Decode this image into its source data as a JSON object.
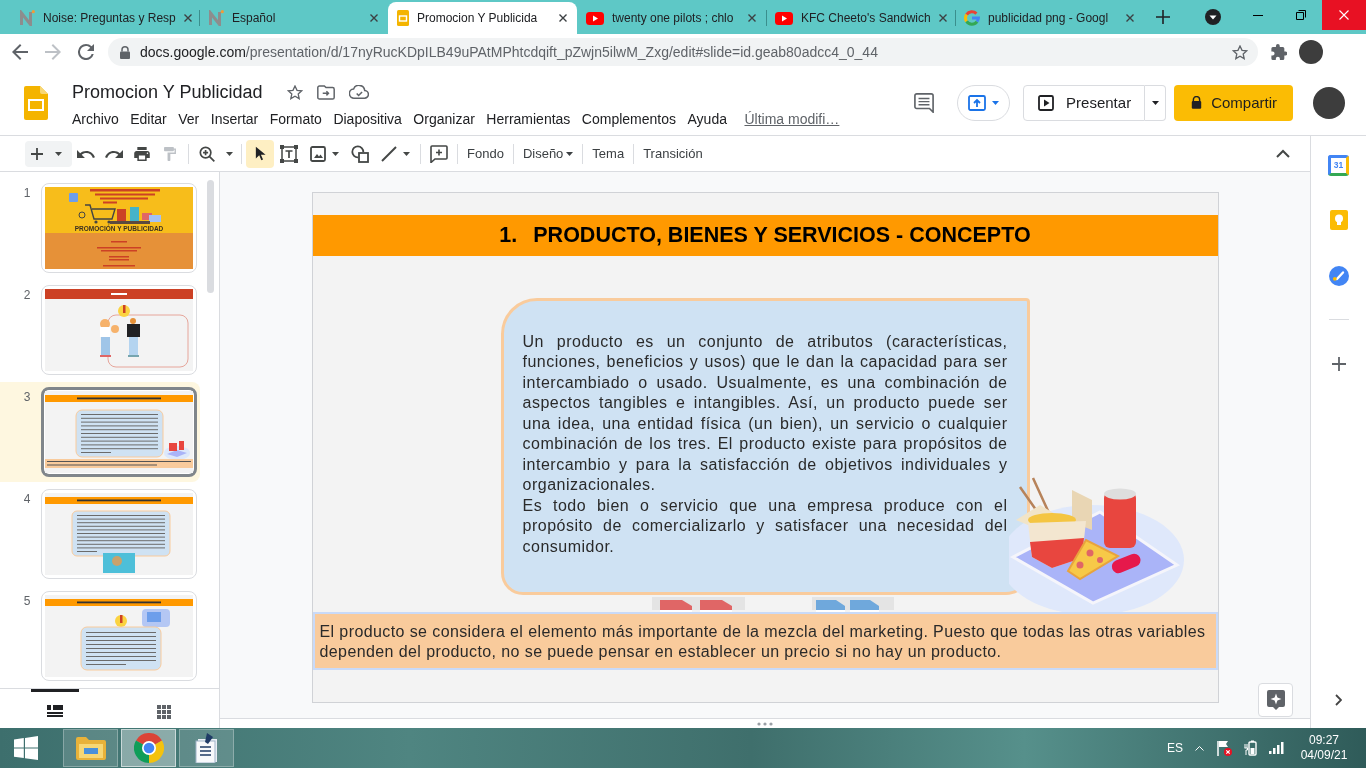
{
  "browser": {
    "tabs": [
      {
        "kind": "noise",
        "title": "Noise: Preguntas y Resp",
        "selected": false
      },
      {
        "kind": "noise",
        "title": "Español",
        "selected": false
      },
      {
        "kind": "slides",
        "title": "Promocion Y Publicida",
        "selected": true
      },
      {
        "kind": "youtube",
        "title": "twenty one pilots ; chlo",
        "selected": false
      },
      {
        "kind": "youtube",
        "title": "KFC Cheeto's Sandwich",
        "selected": false
      },
      {
        "kind": "google",
        "title": "publicidad png - Googl",
        "selected": false
      }
    ],
    "address": {
      "domain": "docs.google.com",
      "path": "/presentation/d/17nyRucKDpILB49uPAtMPhtcdqift_pZwjn5ilwM_Zxg/edit#slide=id.geab80adcc4_0_44"
    }
  },
  "document": {
    "title": "Promocion Y Publicidad",
    "menu": [
      "Archivo",
      "Editar",
      "Ver",
      "Insertar",
      "Formato",
      "Diapositiva",
      "Organizar",
      "Herramientas",
      "Complementos",
      "Ayuda"
    ],
    "last_edit": "Última modifi…",
    "present_button": "Presentar",
    "share_button": "Compartir"
  },
  "toolbar": {
    "tools": [
      {
        "kind": "select",
        "selected": true
      },
      {
        "kind": "textbox",
        "selected": false
      },
      {
        "kind": "image",
        "selected": false
      },
      {
        "kind": "shape",
        "selected": false
      },
      {
        "kind": "line",
        "selected": false
      }
    ],
    "actions": [
      {
        "label": "Fondo",
        "dropdown": false
      },
      {
        "label": "Diseño",
        "dropdown": true
      },
      {
        "label": "Tema",
        "dropdown": false
      },
      {
        "label": "Transición",
        "dropdown": false
      }
    ]
  },
  "filmstrip": {
    "slides": [
      {
        "number": "1",
        "kind": "cover",
        "title": "PROMOCIÓN Y PUBLICIDAD",
        "selected": false
      },
      {
        "number": "2",
        "kind": "figures",
        "selected": false
      },
      {
        "number": "3",
        "kind": "summary",
        "selected": true
      },
      {
        "number": "4",
        "kind": "photo",
        "selected": false
      },
      {
        "number": "5",
        "kind": "icons",
        "selected": false
      }
    ],
    "views": [
      {
        "kind": "list",
        "selected": true
      },
      {
        "kind": "grid",
        "selected": false
      }
    ]
  },
  "slide": {
    "heading_number": "1.",
    "heading": "PRODUCTO, BIENES Y SERVICIOS - CONCEPTO",
    "body": [
      "Un producto es un conjunto de atributos (características, funciones, beneficios y usos) que le dan la capacidad para ser intercambiado o usado. Usualmente, es una combinación de aspectos tangibles e intangibles. Así, un producto puede ser una idea, una entidad física (un bien), un servicio o cualquier combinación de los tres. El producto existe para propósitos de intercambio y para la satisfacción de objetivos individuales y organizacionales.",
      "Es todo bien o servicio que una empresa produce con el propósito de comercializarlo y satisfacer una necesidad del consumidor."
    ],
    "footer": "El producto se considera el elemento más importante de la mezcla del marketing. Puesto que todas las otras variables dependen del producto, no se puede pensar en establecer un precio si no hay un producto."
  },
  "side_panel": {
    "calendar_text": "31"
  },
  "taskbar": {
    "apps": [
      {
        "kind": "explorer",
        "selected": false
      },
      {
        "kind": "chrome",
        "selected": true
      },
      {
        "kind": "document",
        "selected": false
      }
    ],
    "language": "ES",
    "time": "09:27",
    "date": "04/09/21"
  }
}
